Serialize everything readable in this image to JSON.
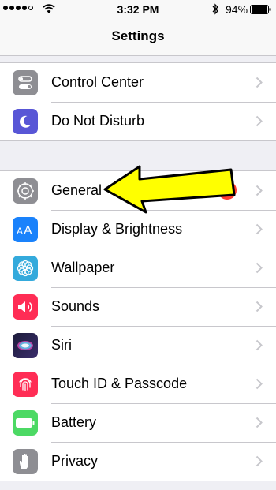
{
  "status_bar": {
    "time": "3:32 PM",
    "battery_percent": "94%",
    "icons": [
      "signal-icon",
      "wifi-icon",
      "bluetooth-icon",
      "battery-icon"
    ]
  },
  "nav": {
    "title": "Settings"
  },
  "groups": [
    {
      "items": [
        {
          "label": "Control Center",
          "icon": "control-center-icon",
          "color": "#8e8e93"
        },
        {
          "label": "Do Not Disturb",
          "icon": "moon-icon",
          "color": "#5856d6"
        }
      ]
    },
    {
      "items": [
        {
          "label": "General",
          "icon": "gear-icon",
          "color": "#8e8e93",
          "badge": "1"
        },
        {
          "label": "Display & Brightness",
          "icon": "aa-icon",
          "color": "#1a82fb"
        },
        {
          "label": "Wallpaper",
          "icon": "flower-icon",
          "color": "#34aadc"
        },
        {
          "label": "Sounds",
          "icon": "speaker-icon",
          "color": "#ff2d55"
        },
        {
          "label": "Siri",
          "icon": "siri-icon",
          "color": "#1c1c3a"
        },
        {
          "label": "Touch ID & Passcode",
          "icon": "fingerprint-icon",
          "color": "#ff2d55"
        },
        {
          "label": "Battery",
          "icon": "battery-setting-icon",
          "color": "#4cd964"
        },
        {
          "label": "Privacy",
          "icon": "hand-icon",
          "color": "#8e8e93"
        }
      ]
    }
  ],
  "colors": {
    "background": "#efeff4",
    "badge": "#ff3b30",
    "arrow": "#ffff00",
    "chevron": "#c7c7cc"
  }
}
